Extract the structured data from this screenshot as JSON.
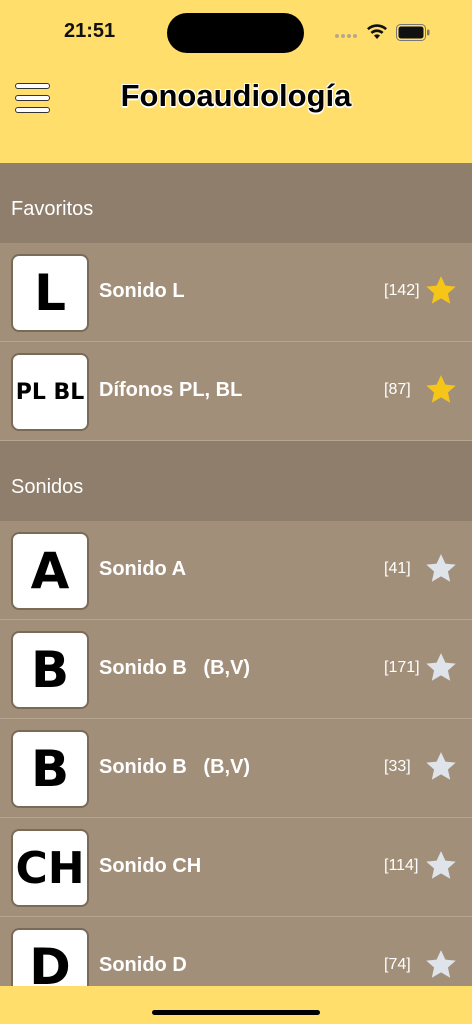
{
  "status": {
    "time": "21:51"
  },
  "app": {
    "title": "Fonoaudiología"
  },
  "sections": [
    {
      "title": "Favoritos",
      "items": [
        {
          "icon_text": "L",
          "label": "Sonido L",
          "count": "[142]",
          "favorite": true
        },
        {
          "icon_text": "PL BL",
          "label": "Dífonos PL, BL",
          "count": "[87]",
          "favorite": true
        }
      ]
    },
    {
      "title": "Sonidos",
      "items": [
        {
          "icon_text": "A",
          "label": "Sonido A",
          "count": "[41]",
          "favorite": false
        },
        {
          "icon_text": "B",
          "label": "Sonido B   (B,V)",
          "count": "[171]",
          "favorite": false
        },
        {
          "icon_text": "B",
          "label": "Sonido B   (B,V)",
          "count": "[33]",
          "favorite": false
        },
        {
          "icon_text": "CH",
          "label": "Sonido CH",
          "count": "[114]",
          "favorite": false
        },
        {
          "icon_text": "D",
          "label": "Sonido D",
          "count": "[74]",
          "favorite": false
        }
      ]
    }
  ],
  "colors": {
    "header_bg": "#ffde6b",
    "section_bg": "#8f7e6b",
    "row_bg": "#a28f7a",
    "star_favorite": "#f5c518",
    "star_default": "#dfe3ea"
  }
}
